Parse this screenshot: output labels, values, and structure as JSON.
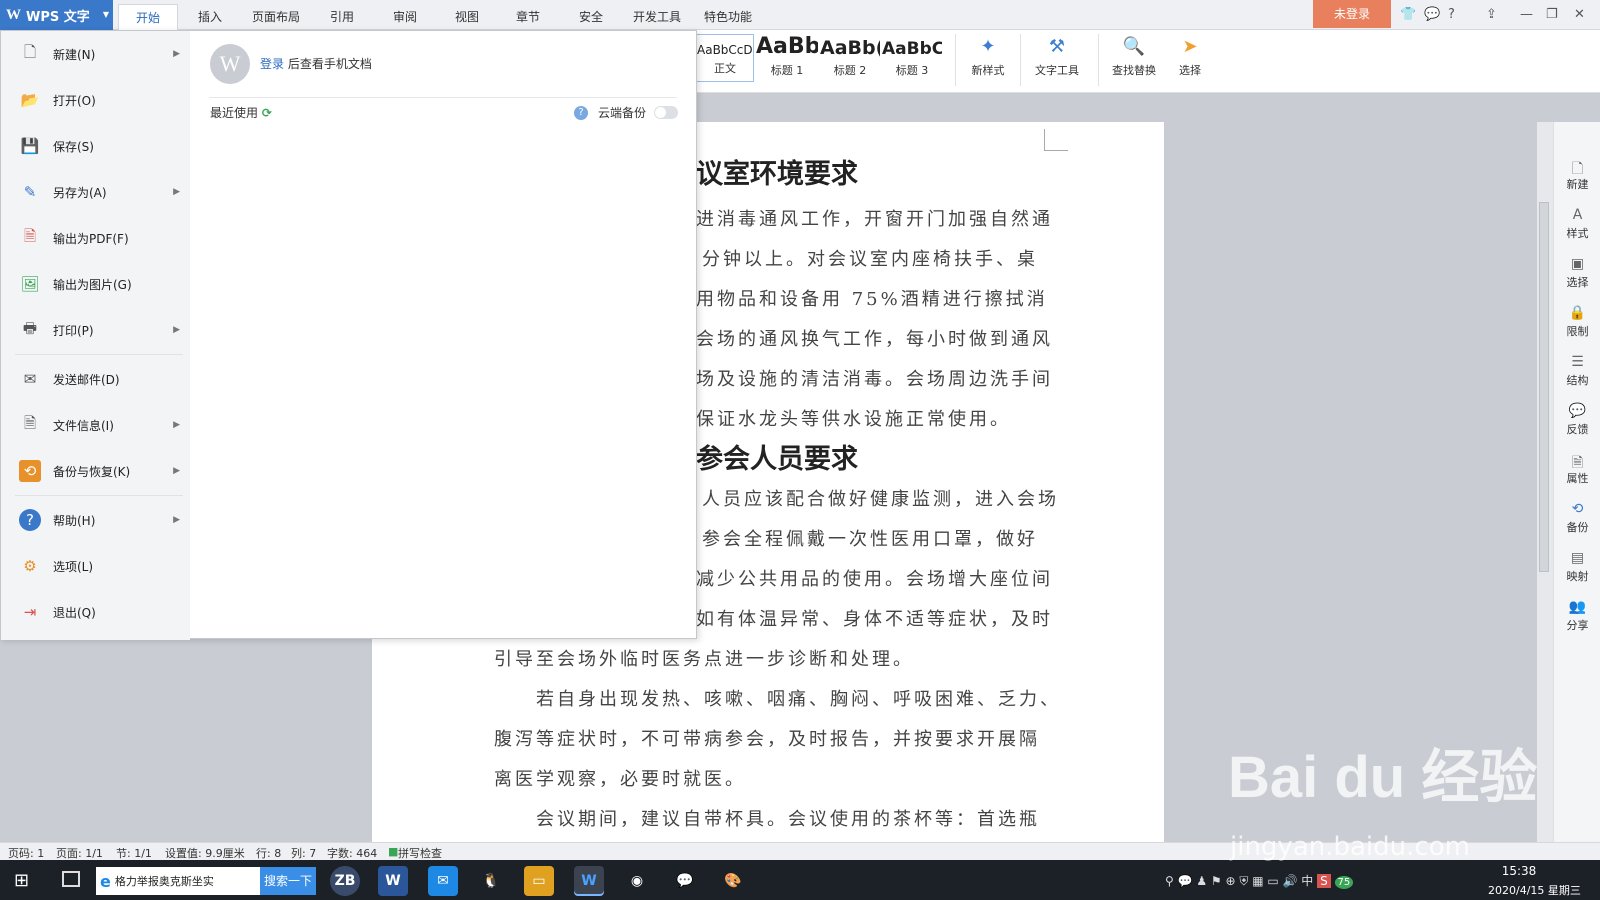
{
  "app": {
    "name": "WPS 文字",
    "login_status": "未登录"
  },
  "menu_tabs": [
    "开始",
    "插入",
    "页面布局",
    "引用",
    "审阅",
    "视图",
    "章节",
    "安全",
    "开发工具",
    "特色功能"
  ],
  "ribbon": {
    "styles": [
      {
        "sample": "AaBbCcDd",
        "name": "正文"
      },
      {
        "sample": "AaBb",
        "name": "标题 1"
      },
      {
        "sample": "AaBb(",
        "name": "标题 2"
      },
      {
        "sample": "AaBbC",
        "name": "标题 3"
      }
    ],
    "tools": [
      "新样式",
      "文字工具",
      "查找替换",
      "选择"
    ]
  },
  "file_menu": {
    "items": [
      {
        "label": "新建(N)",
        "icon": "new-doc-icon",
        "arrow": true
      },
      {
        "label": "打开(O)",
        "icon": "folder-icon",
        "arrow": false
      },
      {
        "label": "保存(S)",
        "icon": "save-icon",
        "arrow": false
      },
      {
        "label": "另存为(A)",
        "icon": "save-as-icon",
        "arrow": true
      },
      {
        "label": "输出为PDF(F)",
        "icon": "pdf-icon",
        "arrow": false
      },
      {
        "label": "输出为图片(G)",
        "icon": "image-export-icon",
        "arrow": false
      },
      {
        "label": "打印(P)",
        "icon": "printer-icon",
        "arrow": true
      },
      {
        "label": "发送邮件(D)",
        "icon": "mail-icon",
        "arrow": false
      },
      {
        "label": "文件信息(I)",
        "icon": "file-info-icon",
        "arrow": true
      },
      {
        "label": "备份与恢复(K)",
        "icon": "backup-icon",
        "arrow": true
      },
      {
        "label": "帮助(H)",
        "icon": "help-icon",
        "arrow": true
      },
      {
        "label": "选项(L)",
        "icon": "gear-icon",
        "arrow": false
      },
      {
        "label": "退出(Q)",
        "icon": "exit-icon",
        "arrow": false
      }
    ],
    "login_link": "登录",
    "login_hint": "后查看手机文档",
    "recent_label": "最近使用",
    "cloud_backup_label": "云端备份"
  },
  "document": {
    "headings": [
      "议室环境要求",
      "参会人员要求"
    ],
    "lines": [
      "进消毒通风工作，开窗开门加强自然通",
      "分钟以上。对会议室内座椅扶手、桌",
      "用物品和设备用 75%酒精进行擦拭消",
      "会场的通风换气工作，每小时做到通风",
      "场及设施的清洁消毒。会场周边洗手间",
      "保证水龙头等供水设施正常使用。",
      "人员应该配合做好健康监测，进入会场",
      "参会全程佩戴一次性医用口罩，做好",
      "减少公共用品的使用。会场增大座位间",
      "如有体温异常、身体不适等症状，及时",
      "引导至会场外临时医务点进一步诊断和处理。",
      "若自身出现发热、咳嗽、咽痛、胸闷、呼吸困难、乏力、",
      "腹泻等症状时，不可带病参会，及时报告，并按要求开展隔",
      "离医学观察，必要时就医。",
      "会议期间，建议自带杯具。会议使用的茶杯等：首选瓶"
    ]
  },
  "sidebar": [
    "新建",
    "样式",
    "选择",
    "限制",
    "结构",
    "反馈",
    "属性",
    "备份",
    "映射",
    "分享"
  ],
  "statusbar": {
    "page_code": "页码: 1",
    "pages": "页面: 1/1",
    "section": "节: 1/1",
    "setting": "设置值: 9.9厘米",
    "row": "行: 8",
    "col": "列: 7",
    "words": "字数: 464",
    "spellcheck": "拼写检查"
  },
  "taskbar": {
    "search_text": "格力举报奥克斯坐实",
    "search_button": "搜索一下",
    "time": "15:38",
    "date": "2020/4/15 星期三",
    "ime": "中",
    "badge": "75"
  },
  "watermark": {
    "main": "Bai du 经验",
    "url": "jingyan.baidu.com"
  },
  "colors": {
    "accent": "#3a78c9",
    "login_button": "#e8805e",
    "taskbar": "#1c2027"
  }
}
